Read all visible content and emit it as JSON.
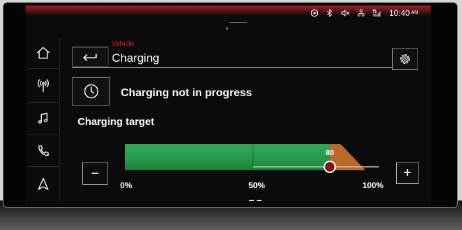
{
  "status_bar": {
    "time": "10:40",
    "period": "AM",
    "icons": [
      "connect-icon",
      "bluetooth-icon",
      "mute-icon",
      "user-icon",
      "mobile-signal-icon"
    ]
  },
  "sidebar": {
    "items": [
      {
        "icon": "home-icon"
      },
      {
        "icon": "radio-icon"
      },
      {
        "icon": "music-icon"
      },
      {
        "icon": "phone-icon"
      },
      {
        "icon": "navigation-icon"
      }
    ]
  },
  "header": {
    "breadcrumb": "Vehicle",
    "title": "Charging",
    "back_icon": "back-icon",
    "settings_icon": "gear-icon"
  },
  "charging_status": {
    "icon": "clock-icon",
    "text": "Charging not in progress"
  },
  "charging_target": {
    "heading": "Charging target",
    "value": 80,
    "scale": [
      0,
      100
    ],
    "track_range": [
      50,
      100
    ],
    "tick_labels": [
      "0%",
      "50%",
      "100%"
    ],
    "decrease_label": "−",
    "increase_label": "+"
  },
  "page_indicator": {
    "pages": 2
  },
  "colors": {
    "accent_red": "#e2222e",
    "fill_green": "#1c9e45",
    "overflow_orange": "#b8692b",
    "handle_red": "#7c1616",
    "text": "#ffffff",
    "background": "#0b0b0d"
  }
}
